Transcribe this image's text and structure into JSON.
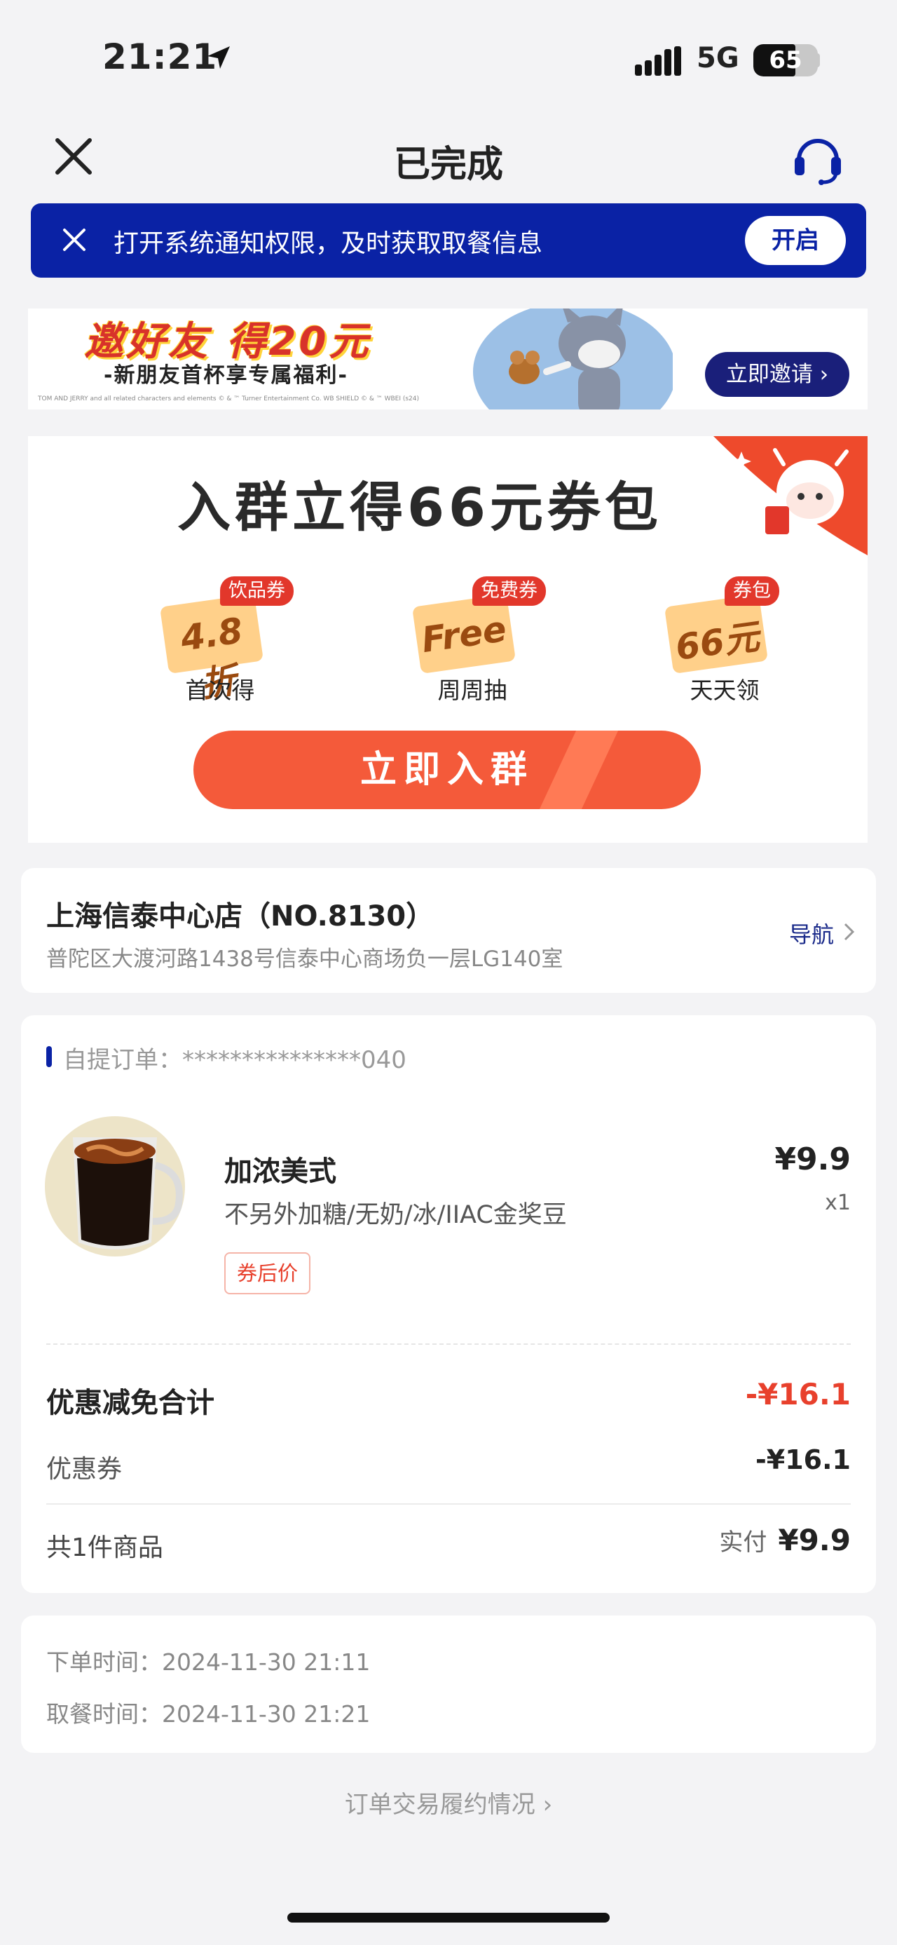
{
  "status_bar": {
    "time": "21:21",
    "network": "5G",
    "battery": "65",
    "battery_level": 0.65
  },
  "header": {
    "title": "已完成",
    "close_icon": "close-icon",
    "service_icon": "headset-icon"
  },
  "notice": {
    "text": "打开系统通知权限，及时获取取餐信息",
    "button": "开启"
  },
  "invite_banner": {
    "title": "邀好友 得20元",
    "subtitle": "-新朋友首杯享专属福利-",
    "fine_print": "TOM AND JERRY and all related characters and elements © & ™ Turner Entertainment Co. WB SHIELD © & ™ WBEI (s24)",
    "button": "立即邀请"
  },
  "group_promo": {
    "title": "入群立得66元券包",
    "perks": [
      {
        "badge": "饮品券",
        "value": "4.8折",
        "label": "首次得"
      },
      {
        "badge": "免费券",
        "value": "Free",
        "label": "周周抽"
      },
      {
        "badge": "券包",
        "value": "66元",
        "label": "天天领"
      }
    ],
    "button": "立即入群"
  },
  "store": {
    "name": "上海信泰中心店（NO.8130）",
    "address": "普陀区大渡河路1438号信泰中心商场负一层LG140室",
    "nav_label": "导航"
  },
  "order": {
    "id_label": "自提订单：***************040",
    "item": {
      "name": "加浓美式",
      "spec": "不另外加糖/无奶/冰/IIAC金奖豆",
      "tag": "券后价",
      "price": "¥9.9",
      "qty": "x1"
    },
    "discount_total_label": "优惠减免合计",
    "discount_total_value": "-¥16.1",
    "coupon_label": "优惠券",
    "coupon_value": "-¥16.1",
    "count_label": "共1件商品",
    "paid_label": "实付",
    "paid_value": "¥9.9"
  },
  "times": {
    "order_time": "下单时间：2024-11-30 21:11",
    "pickup_time": "取餐时间：2024-11-30 21:21"
  },
  "footer_link": "订单交易履约情况",
  "colors": {
    "brand_blue": "#0a22a5",
    "accent_red": "#e8402c",
    "page_bg": "#f3f3f5"
  }
}
